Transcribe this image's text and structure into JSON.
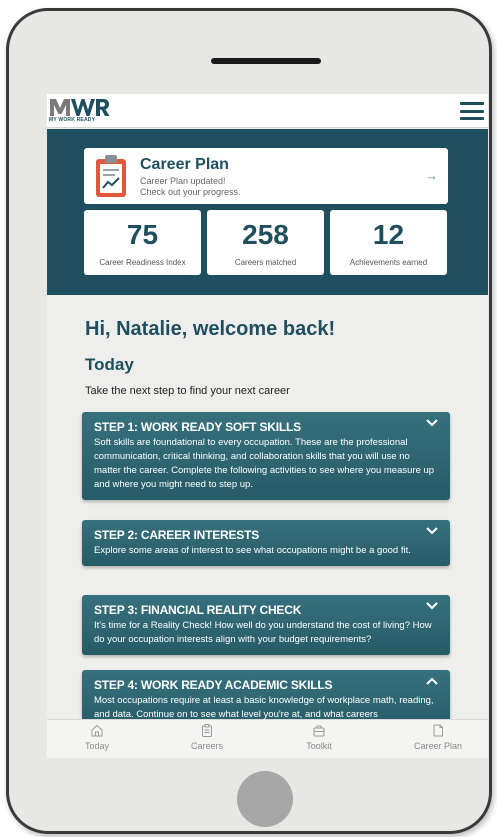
{
  "app": {
    "logo_text": "MY WORK READY"
  },
  "career_plan": {
    "title": "Career Plan",
    "line1": "Career Plan updated!",
    "line2": "Check out your progress.",
    "arrow": "→"
  },
  "stats": [
    {
      "value": "75",
      "label": "Career Readiness Index"
    },
    {
      "value": "258",
      "label": "Careers matched"
    },
    {
      "value": "12",
      "label": "Achievements earned"
    }
  ],
  "greeting": "Hi, Natalie, welcome back!",
  "today": {
    "heading": "Today",
    "intro": "Take the next step to find your next career"
  },
  "steps": [
    {
      "title": "STEP 1: WORK READY SOFT SKILLS",
      "desc": "Soft skills are foundational to every occupation. These are the professional communication, critical thinking, and collaboration skills that you will use no matter the career. Complete the following activities to see where you measure up and where you might need to step up.",
      "expanded": false
    },
    {
      "title": "STEP 2: CAREER INTERESTS",
      "desc": "Explore some areas of interest to see what occupations might be a good fit.",
      "expanded": false
    },
    {
      "title": "STEP 3: FINANCIAL REALITY CHECK",
      "desc": "It's time for a Reality Check! How well do you understand the cost of living? How do your occupation interests align with your budget requirements?",
      "expanded": false
    },
    {
      "title": "STEP 4: WORK READY ACADEMIC SKILLS",
      "desc": "Most occupations require at least a basic knowledge of workplace math, reading, and data. Continue on to see what level you're at, and what careers",
      "expanded": true
    }
  ],
  "bottom_nav": [
    {
      "label": "Today",
      "icon": "home-icon"
    },
    {
      "label": "Careers",
      "icon": "clipboard-icon"
    },
    {
      "label": "Toolkit",
      "icon": "toolbox-icon"
    },
    {
      "label": "Career Plan",
      "icon": "document-icon"
    }
  ],
  "colors": {
    "brand": "#1f4f5f",
    "step_bg": "#2d6673",
    "screen_bg": "#eeeeec",
    "device_bg": "#e7e8e3"
  }
}
